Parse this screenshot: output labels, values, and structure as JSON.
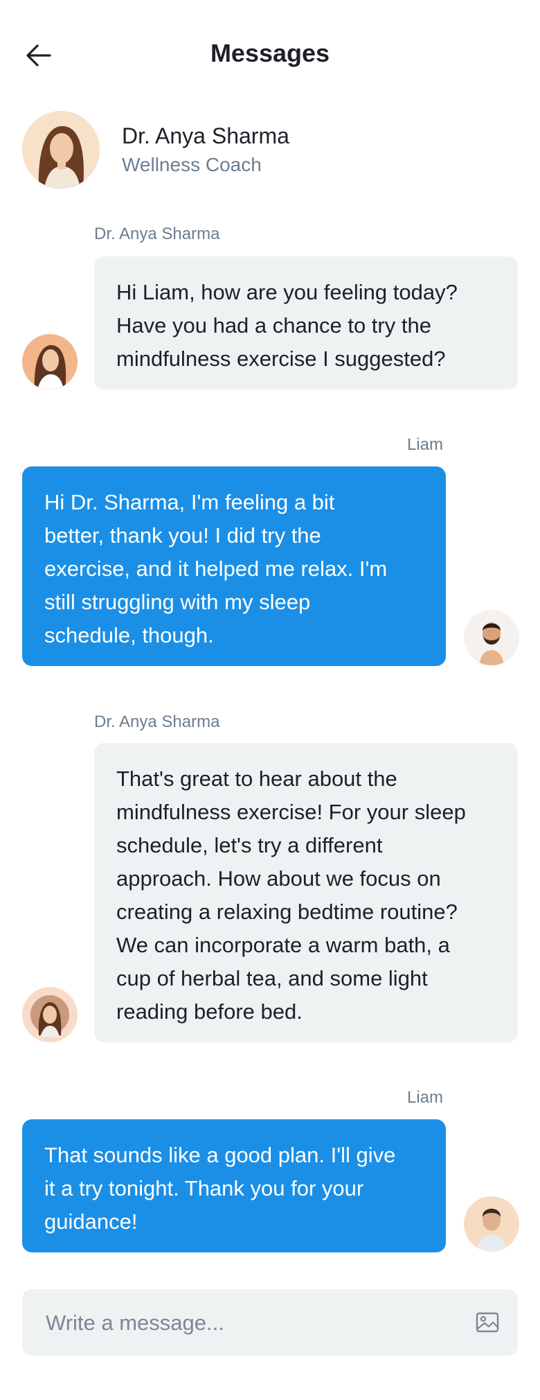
{
  "header": {
    "title": "Messages"
  },
  "contact": {
    "name": "Dr. Anya Sharma",
    "role": "Wellness Coach"
  },
  "messages": [
    {
      "sender": "Dr. Anya Sharma",
      "lines": [
        "Hi Liam, how are you feeling today?",
        "Have you had a chance to try the",
        "mindfulness exercise I suggested?"
      ]
    },
    {
      "sender": "Liam",
      "lines": [
        "Hi Dr. Sharma, I'm feeling a bit",
        "better, thank you! I did try the",
        "exercise, and it helped me relax. I'm",
        "still struggling with my sleep",
        "schedule, though."
      ]
    },
    {
      "sender": "Dr. Anya Sharma",
      "lines": [
        "That's great to hear about the",
        "mindfulness exercise! For your sleep",
        "schedule, let's try a different",
        "approach. How about we focus on",
        "creating a relaxing bedtime routine?",
        "We can incorporate a warm bath, a",
        "cup of herbal tea, and some light",
        "reading before bed."
      ]
    },
    {
      "sender": "Liam",
      "lines": [
        "That sounds like a good plan. I'll give",
        "it a try tonight. Thank you for your",
        "guidance!"
      ]
    }
  ],
  "composer": {
    "placeholder": "Write a message..."
  },
  "icons": {
    "back": "arrow-left-icon",
    "attach": "image-icon"
  },
  "colors": {
    "accent": "#1b8fe6",
    "incoming": "#eff2f3",
    "muted": "#6c7d8e"
  }
}
